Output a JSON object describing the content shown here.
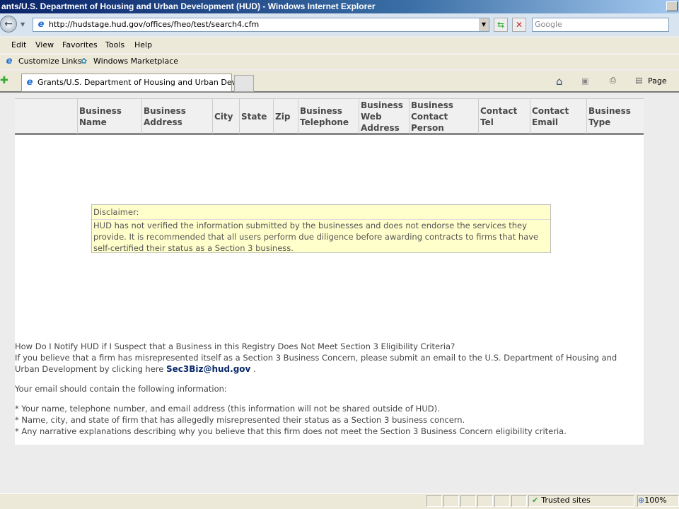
{
  "window": {
    "title": "ants/U.S. Department of Housing and Urban Development (HUD) - Windows Internet Explorer"
  },
  "nav": {
    "url": "http://hudstage.hud.gov/offices/fheo/test/search4.cfm",
    "search_placeholder": "Google"
  },
  "menu": [
    "Edit",
    "View",
    "Favorites",
    "Tools",
    "Help"
  ],
  "links": [
    "Customize Links",
    "Windows Marketplace"
  ],
  "tab": {
    "title": "Grants/U.S. Department of Housing and Urban Devel..."
  },
  "toolbar": {
    "page": "Page"
  },
  "table": {
    "headers": [
      "Business\nName",
      "Business\nAddress",
      "City",
      "State",
      "Zip",
      "Business\nTelephone",
      "Business\nWeb\nAddress",
      "Business\nContact\nPerson",
      "Contact\nTel",
      "Contact\nEmail",
      "Business\nType"
    ]
  },
  "disclaimer": {
    "heading": "Disclaimer:",
    "body": "HUD has not verified the information submitted by the businesses and does not endorse the services they provide. It is recommended that all users perform due diligence before awarding contracts to firms that have self-certified their status as a Section 3 business."
  },
  "notify": {
    "question": "How Do I Notify HUD if I Suspect that a Business in this Registry Does Not Meet Section 3 Eligibility Criteria?",
    "text": "If you believe that a firm has misrepresented itself as a Section 3 Business Concern, please submit an email to the U.S. Department of Housing and Urban Development by clicking here ",
    "email": "Sec3Biz@hud.gov",
    "after": " .",
    "intro": "Your email should contain the following information:",
    "items": [
      "* Your name, telephone number, and email address (this information will not be shared outside of HUD).",
      "* Name, city, and state of firm that has allegedly misrepresented their status as a Section 3 business concern.",
      "* Any narrative explanations describing why you believe that this firm does not meet the Section 3 Business Concern eligibility criteria."
    ]
  },
  "status": {
    "zone": "Trusted sites",
    "zoom": "100%"
  }
}
